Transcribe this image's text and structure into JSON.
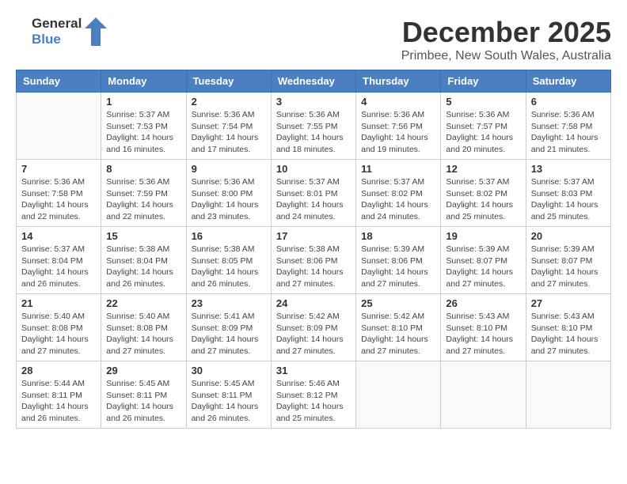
{
  "header": {
    "logo_line1": "General",
    "logo_line2": "Blue",
    "month": "December 2025",
    "location": "Primbee, New South Wales, Australia"
  },
  "days_of_week": [
    "Sunday",
    "Monday",
    "Tuesday",
    "Wednesday",
    "Thursday",
    "Friday",
    "Saturday"
  ],
  "weeks": [
    [
      {
        "day": "",
        "info": ""
      },
      {
        "day": "1",
        "info": "Sunrise: 5:37 AM\nSunset: 7:53 PM\nDaylight: 14 hours\nand 16 minutes."
      },
      {
        "day": "2",
        "info": "Sunrise: 5:36 AM\nSunset: 7:54 PM\nDaylight: 14 hours\nand 17 minutes."
      },
      {
        "day": "3",
        "info": "Sunrise: 5:36 AM\nSunset: 7:55 PM\nDaylight: 14 hours\nand 18 minutes."
      },
      {
        "day": "4",
        "info": "Sunrise: 5:36 AM\nSunset: 7:56 PM\nDaylight: 14 hours\nand 19 minutes."
      },
      {
        "day": "5",
        "info": "Sunrise: 5:36 AM\nSunset: 7:57 PM\nDaylight: 14 hours\nand 20 minutes."
      },
      {
        "day": "6",
        "info": "Sunrise: 5:36 AM\nSunset: 7:58 PM\nDaylight: 14 hours\nand 21 minutes."
      }
    ],
    [
      {
        "day": "7",
        "info": "Sunrise: 5:36 AM\nSunset: 7:58 PM\nDaylight: 14 hours\nand 22 minutes."
      },
      {
        "day": "8",
        "info": "Sunrise: 5:36 AM\nSunset: 7:59 PM\nDaylight: 14 hours\nand 22 minutes."
      },
      {
        "day": "9",
        "info": "Sunrise: 5:36 AM\nSunset: 8:00 PM\nDaylight: 14 hours\nand 23 minutes."
      },
      {
        "day": "10",
        "info": "Sunrise: 5:37 AM\nSunset: 8:01 PM\nDaylight: 14 hours\nand 24 minutes."
      },
      {
        "day": "11",
        "info": "Sunrise: 5:37 AM\nSunset: 8:02 PM\nDaylight: 14 hours\nand 24 minutes."
      },
      {
        "day": "12",
        "info": "Sunrise: 5:37 AM\nSunset: 8:02 PM\nDaylight: 14 hours\nand 25 minutes."
      },
      {
        "day": "13",
        "info": "Sunrise: 5:37 AM\nSunset: 8:03 PM\nDaylight: 14 hours\nand 25 minutes."
      }
    ],
    [
      {
        "day": "14",
        "info": "Sunrise: 5:37 AM\nSunset: 8:04 PM\nDaylight: 14 hours\nand 26 minutes."
      },
      {
        "day": "15",
        "info": "Sunrise: 5:38 AM\nSunset: 8:04 PM\nDaylight: 14 hours\nand 26 minutes."
      },
      {
        "day": "16",
        "info": "Sunrise: 5:38 AM\nSunset: 8:05 PM\nDaylight: 14 hours\nand 26 minutes."
      },
      {
        "day": "17",
        "info": "Sunrise: 5:38 AM\nSunset: 8:06 PM\nDaylight: 14 hours\nand 27 minutes."
      },
      {
        "day": "18",
        "info": "Sunrise: 5:39 AM\nSunset: 8:06 PM\nDaylight: 14 hours\nand 27 minutes."
      },
      {
        "day": "19",
        "info": "Sunrise: 5:39 AM\nSunset: 8:07 PM\nDaylight: 14 hours\nand 27 minutes."
      },
      {
        "day": "20",
        "info": "Sunrise: 5:39 AM\nSunset: 8:07 PM\nDaylight: 14 hours\nand 27 minutes."
      }
    ],
    [
      {
        "day": "21",
        "info": "Sunrise: 5:40 AM\nSunset: 8:08 PM\nDaylight: 14 hours\nand 27 minutes."
      },
      {
        "day": "22",
        "info": "Sunrise: 5:40 AM\nSunset: 8:08 PM\nDaylight: 14 hours\nand 27 minutes."
      },
      {
        "day": "23",
        "info": "Sunrise: 5:41 AM\nSunset: 8:09 PM\nDaylight: 14 hours\nand 27 minutes."
      },
      {
        "day": "24",
        "info": "Sunrise: 5:42 AM\nSunset: 8:09 PM\nDaylight: 14 hours\nand 27 minutes."
      },
      {
        "day": "25",
        "info": "Sunrise: 5:42 AM\nSunset: 8:10 PM\nDaylight: 14 hours\nand 27 minutes."
      },
      {
        "day": "26",
        "info": "Sunrise: 5:43 AM\nSunset: 8:10 PM\nDaylight: 14 hours\nand 27 minutes."
      },
      {
        "day": "27",
        "info": "Sunrise: 5:43 AM\nSunset: 8:10 PM\nDaylight: 14 hours\nand 27 minutes."
      }
    ],
    [
      {
        "day": "28",
        "info": "Sunrise: 5:44 AM\nSunset: 8:11 PM\nDaylight: 14 hours\nand 26 minutes."
      },
      {
        "day": "29",
        "info": "Sunrise: 5:45 AM\nSunset: 8:11 PM\nDaylight: 14 hours\nand 26 minutes."
      },
      {
        "day": "30",
        "info": "Sunrise: 5:45 AM\nSunset: 8:11 PM\nDaylight: 14 hours\nand 26 minutes."
      },
      {
        "day": "31",
        "info": "Sunrise: 5:46 AM\nSunset: 8:12 PM\nDaylight: 14 hours\nand 25 minutes."
      },
      {
        "day": "",
        "info": ""
      },
      {
        "day": "",
        "info": ""
      },
      {
        "day": "",
        "info": ""
      }
    ]
  ]
}
